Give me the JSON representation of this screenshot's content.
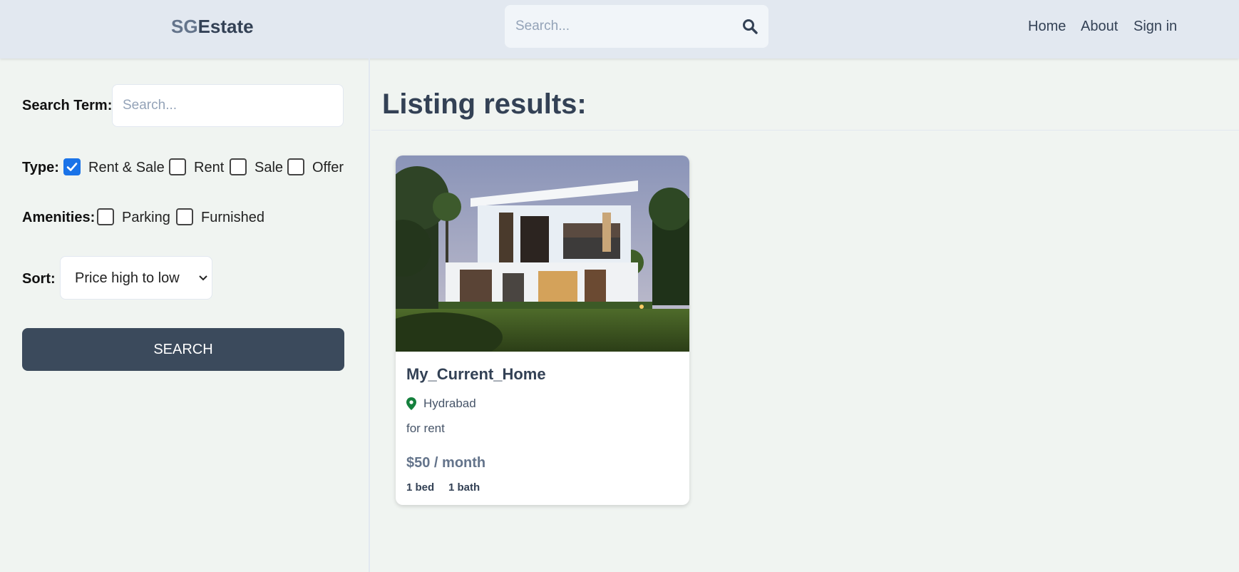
{
  "header": {
    "logo_part1": "SG",
    "logo_part2": "Estate",
    "search_placeholder": "Search...",
    "nav": [
      "Home",
      "About",
      "Sign in"
    ]
  },
  "sidebar": {
    "search_term_label": "Search Term:",
    "search_placeholder": "Search...",
    "type_label": "Type:",
    "types": [
      {
        "label": "Rent & Sale",
        "checked": true
      },
      {
        "label": "Rent",
        "checked": false
      },
      {
        "label": "Sale",
        "checked": false
      },
      {
        "label": "Offer",
        "checked": false
      }
    ],
    "amenities_label": "Amenities:",
    "amenities": [
      {
        "label": "Parking",
        "checked": false
      },
      {
        "label": "Furnished",
        "checked": false
      }
    ],
    "sort_label": "Sort:",
    "sort_value": "Price high to low",
    "search_button": "SEARCH"
  },
  "main": {
    "heading": "Listing results:",
    "listings": [
      {
        "title": "My_Current_Home",
        "location": "Hydrabad",
        "description": "for rent",
        "price": "$50 / month",
        "beds": "1 bed",
        "baths": "1 bath"
      }
    ]
  },
  "colors": {
    "header_bg": "#e2e8f0",
    "page_bg": "#f0f4f1",
    "button_bg": "#3b4a5c",
    "checkbox_checked": "#1a73e8",
    "pin": "#15803d"
  }
}
